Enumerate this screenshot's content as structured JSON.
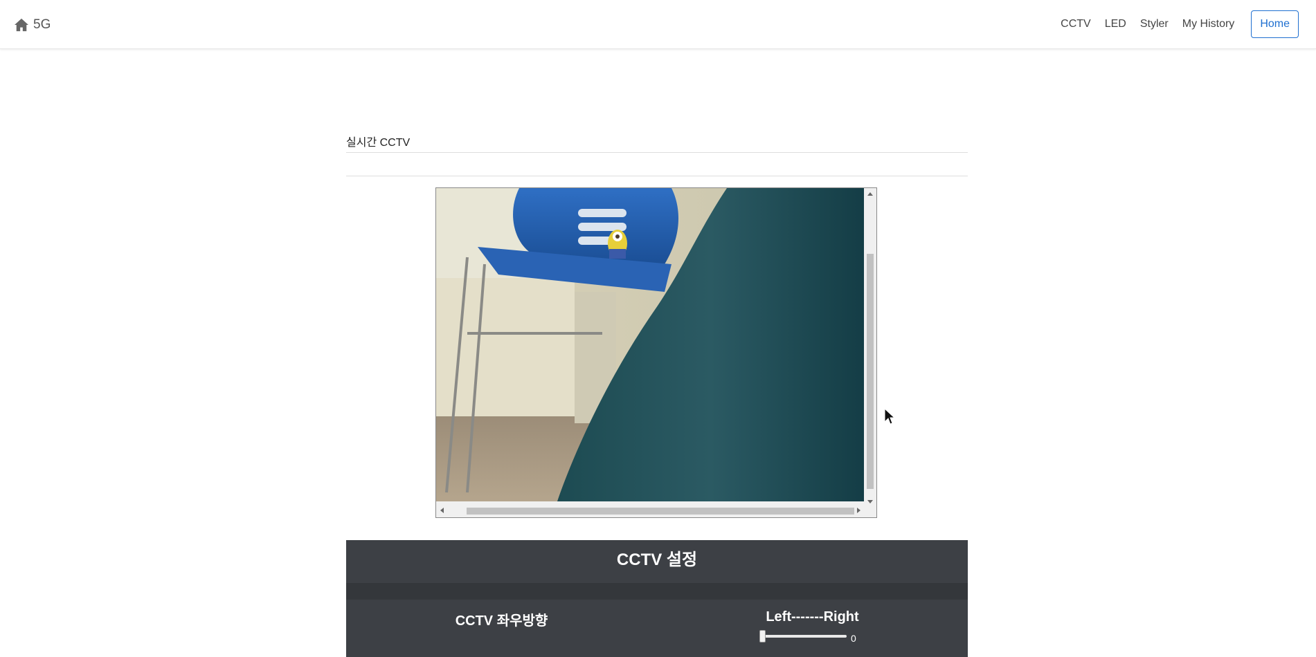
{
  "navbar": {
    "brand_label": "5G",
    "links": [
      "CCTV",
      "LED",
      "Styler",
      "My History"
    ],
    "home_button": "Home",
    "accent_color": "#1e6fd0"
  },
  "page": {
    "section_title": "실시간 CCTV"
  },
  "settings": {
    "title": "CCTV 설정",
    "rows": [
      {
        "label": "CCTV 좌우방향",
        "control_label": "Left-------Right",
        "value": "0"
      }
    ],
    "panel_color": "#3d4045"
  }
}
